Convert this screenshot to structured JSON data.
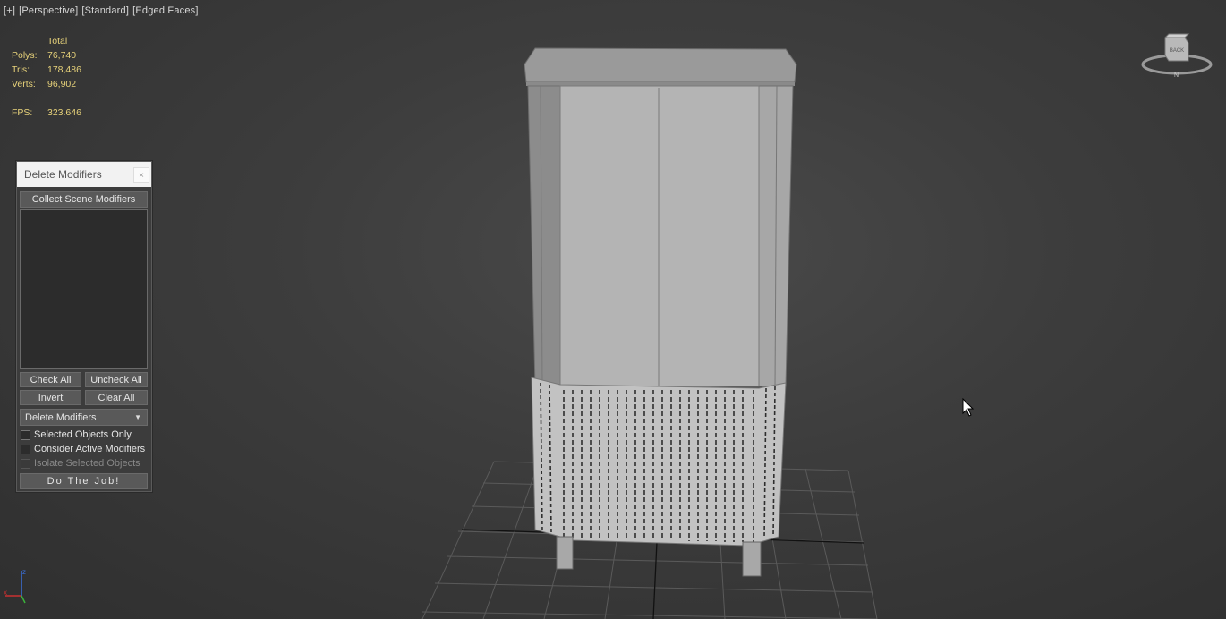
{
  "viewport": {
    "label_plus": "[+]",
    "label_view": "[Perspective]",
    "label_shading": "[Standard]",
    "label_mode": "[Edged Faces]"
  },
  "stats": {
    "header": "Total",
    "polys_label": "Polys:",
    "polys_value": "76,740",
    "tris_label": "Tris:",
    "tris_value": "178,486",
    "verts_label": "Verts:",
    "verts_value": "96,902",
    "fps_label": "FPS:",
    "fps_value": "323.646"
  },
  "dialog": {
    "title": "Delete Modifiers",
    "close": "×",
    "collect_button": "Collect Scene Modifiers",
    "check_all": "Check All",
    "uncheck_all": "Uncheck All",
    "invert": "Invert",
    "clear_all": "Clear All",
    "dropdown_selected": "Delete Modifiers",
    "opt_selected_only": "Selected Objects Only",
    "opt_consider_active": "Consider Active Modifiers",
    "opt_isolate": "Isolate Selected Objects",
    "do_job": "Do The Job!"
  },
  "navcube": {
    "face_label": "BACK",
    "compass_label": "N"
  },
  "gizmo": {
    "z": "z",
    "x": "x"
  },
  "icons": [
    "close-icon",
    "dropdown-arrow-icon",
    "axis-gizmo-icon",
    "viewcube-icon",
    "mouse-cursor-icon"
  ]
}
